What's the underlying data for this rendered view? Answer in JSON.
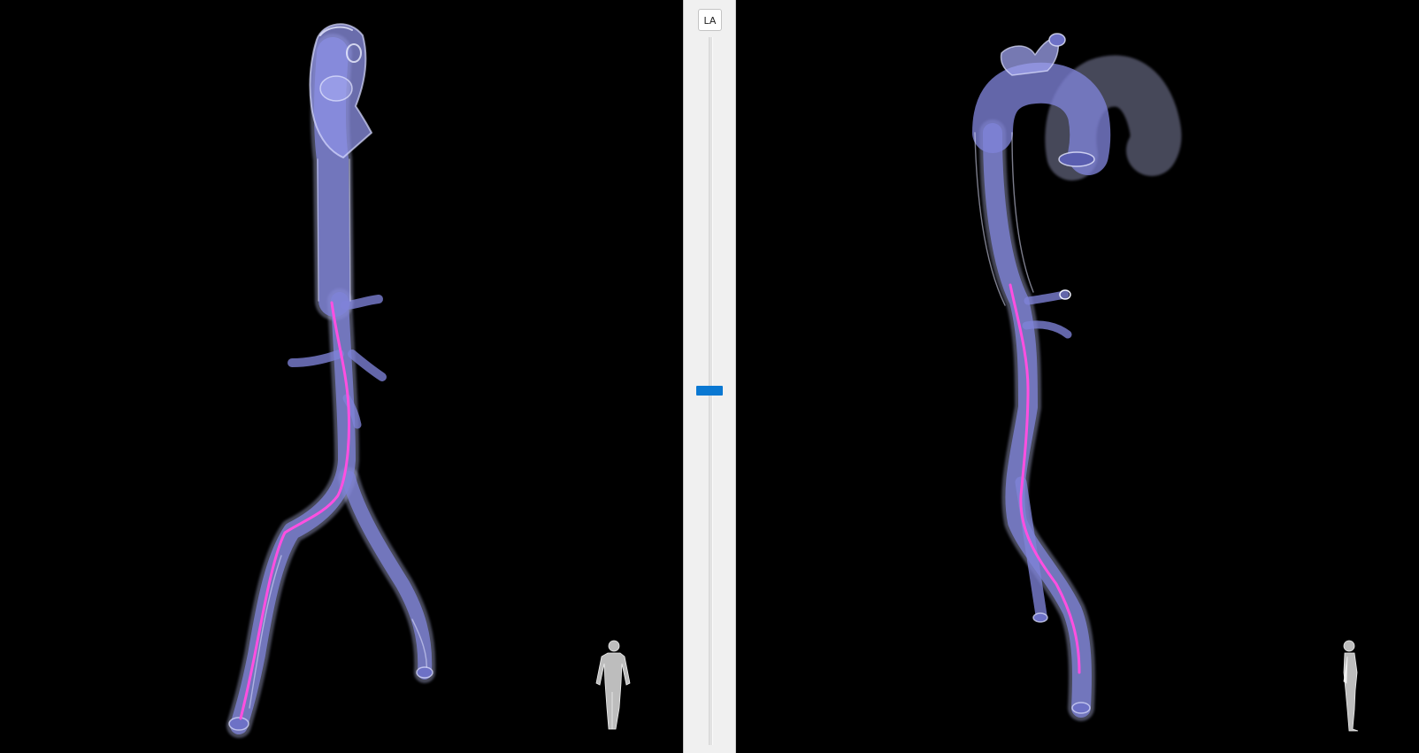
{
  "center_panel": {
    "label_button": "LA",
    "slider": {
      "value_fraction": 0.5
    }
  },
  "left_view": {
    "icon": "body-orientation-icon-front"
  },
  "right_view": {
    "icon": "body-orientation-icon-side"
  },
  "colors": {
    "background": "#000000",
    "vessel_fill": "#8a8ee8",
    "vessel_edge": "#d8dcff",
    "centerline": "#ff4fe0",
    "slider_thumb": "#0a78d2",
    "panel": "#f0f0f0"
  }
}
